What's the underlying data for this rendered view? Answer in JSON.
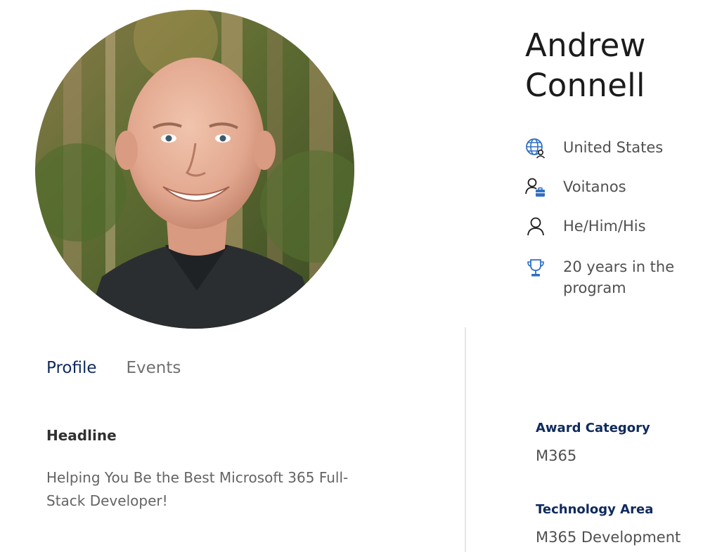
{
  "profile": {
    "name_first": "Andrew",
    "name_last": "Connell",
    "photo_alt": "Profile photo"
  },
  "facts": {
    "country": {
      "icon": "globe-person-icon",
      "text": "United States"
    },
    "company": {
      "icon": "person-briefcase-icon",
      "text": "Voitanos"
    },
    "pronouns": {
      "icon": "person-icon",
      "text": "He/Him/His"
    },
    "years": {
      "icon": "trophy-icon",
      "text": "20 years in the program"
    }
  },
  "tabs": [
    {
      "label": "Profile",
      "active": true
    },
    {
      "label": "Events",
      "active": false
    }
  ],
  "headline": {
    "label": "Headline",
    "text": "Helping You Be the Best Microsoft 365 Full-Stack Developer!"
  },
  "details": {
    "award_category_label": "Award Category",
    "award_category_value": "M365",
    "technology_area_label": "Technology Area",
    "technology_area_value": "M365 Development"
  },
  "colors": {
    "accent": "#0f2a5c",
    "icon_blue": "#2f6fc2",
    "text_secondary": "#505050",
    "divider": "#e6e6e6"
  }
}
